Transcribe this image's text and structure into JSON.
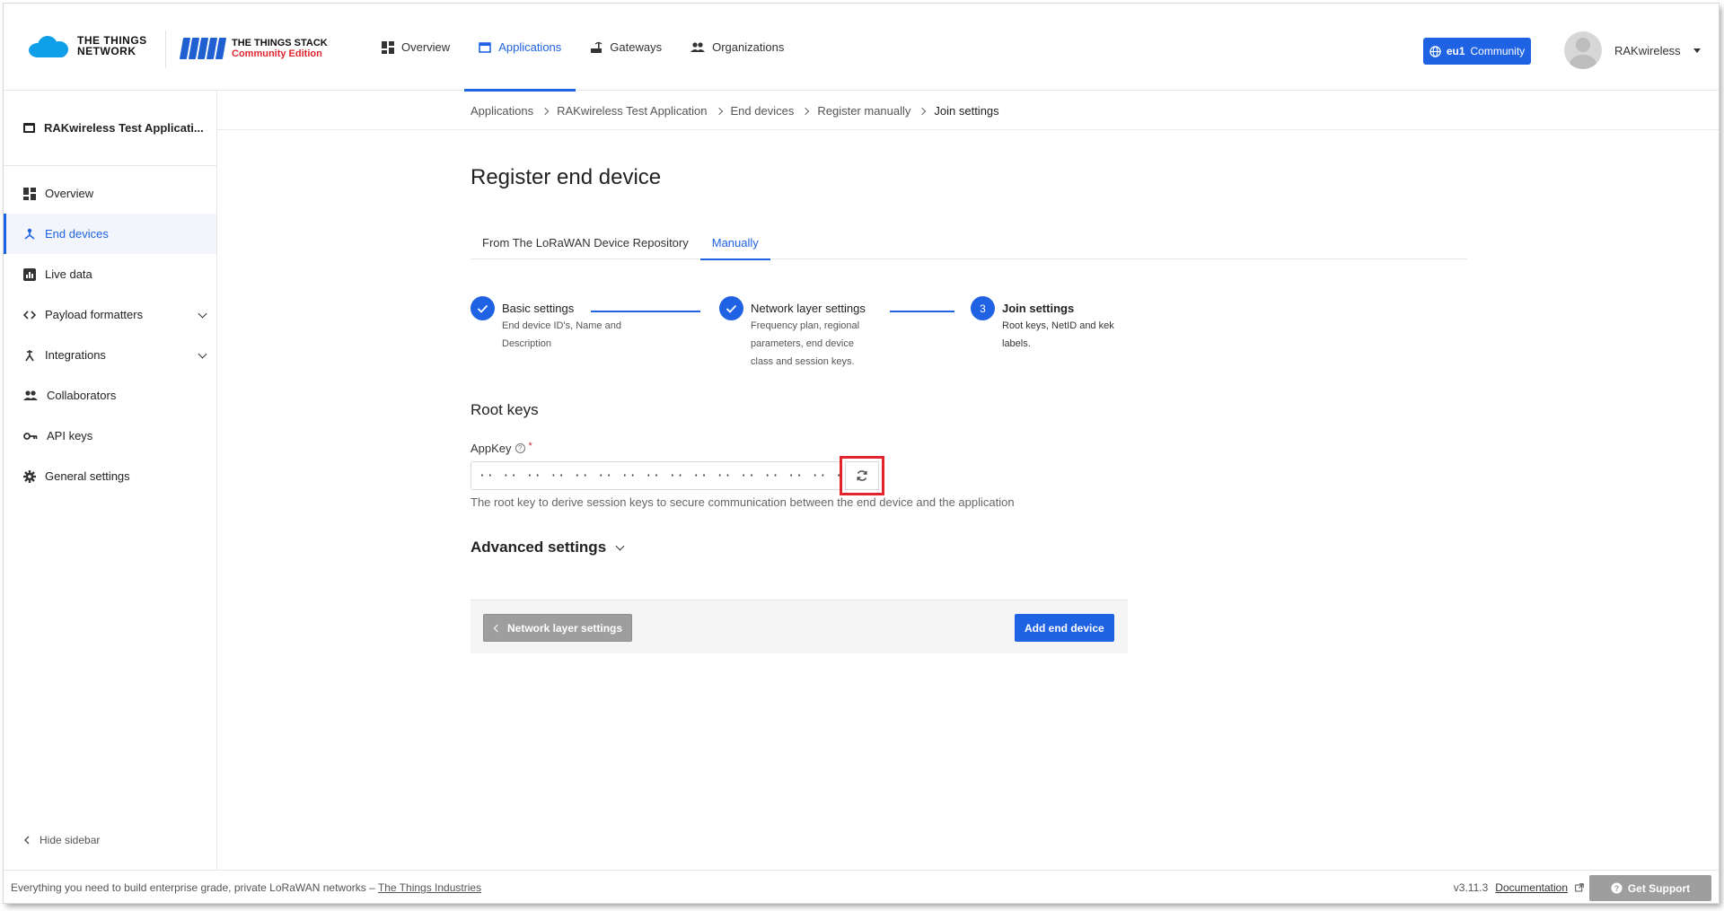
{
  "header": {
    "logo_ttn_line1": "THE THINGS",
    "logo_ttn_line2": "NETWORK",
    "logo_tts_line1": "THE THINGS STACK",
    "logo_tts_line2": "Community Edition",
    "nav": [
      {
        "label": "Overview",
        "icon": "grid-icon"
      },
      {
        "label": "Applications",
        "icon": "window-icon",
        "active": true
      },
      {
        "label": "Gateways",
        "icon": "gateway-icon"
      },
      {
        "label": "Organizations",
        "icon": "people-icon"
      }
    ],
    "cluster_region": "eu1",
    "cluster_label": "Community",
    "username": "RAKwireless"
  },
  "sidebar": {
    "app_name": "RAKwireless Test Applicati...",
    "items": [
      {
        "label": "Overview",
        "icon": "grid-icon"
      },
      {
        "label": "End devices",
        "icon": "device-icon",
        "active": true
      },
      {
        "label": "Live data",
        "icon": "chart-icon"
      },
      {
        "label": "Payload formatters",
        "icon": "code-icon",
        "expandable": true
      },
      {
        "label": "Integrations",
        "icon": "integration-icon",
        "expandable": true
      },
      {
        "label": "Collaborators",
        "icon": "people-icon"
      },
      {
        "label": "API keys",
        "icon": "key-icon"
      },
      {
        "label": "General settings",
        "icon": "gear-icon"
      }
    ],
    "hide_label": "Hide sidebar"
  },
  "breadcrumb": [
    "Applications",
    "RAKwireless Test Application",
    "End devices",
    "Register manually",
    "Join settings"
  ],
  "page": {
    "title": "Register end device",
    "tabs": [
      {
        "label": "From The LoRaWAN Device Repository"
      },
      {
        "label": "Manually",
        "active": true
      }
    ],
    "steps": [
      {
        "title": "Basic settings",
        "desc": "End device ID's, Name and Description",
        "state": "done"
      },
      {
        "title": "Network layer settings",
        "desc": "Frequency plan, regional parameters, end device class and session keys.",
        "state": "done"
      },
      {
        "number": "3",
        "title": "Join settings",
        "desc": "Root keys, NetID and kek labels.",
        "state": "current"
      }
    ],
    "root_keys_heading": "Root keys",
    "appkey_label": "AppKey",
    "appkey_required": "*",
    "appkey_value": "·· ·· ·· ·· ·· ·· ·· ·· ·· ·· ·· ·· ·· ·· ·· ··",
    "appkey_desc": "The root key to derive session keys to secure communication between the end device and the application",
    "advanced_label": "Advanced settings",
    "back_button": "Network layer settings",
    "submit_button": "Add end device"
  },
  "footer": {
    "tagline": "Everything you need to build enterprise grade, private LoRaWAN networks – ",
    "tagline_link": "The Things Industries",
    "version": "v3.11.3",
    "docs_link": "Documentation",
    "support_button": "Get Support"
  },
  "colors": {
    "accent": "#1f63e4",
    "highlight": "#e0252f",
    "muted_button": "#9e9e9e"
  }
}
